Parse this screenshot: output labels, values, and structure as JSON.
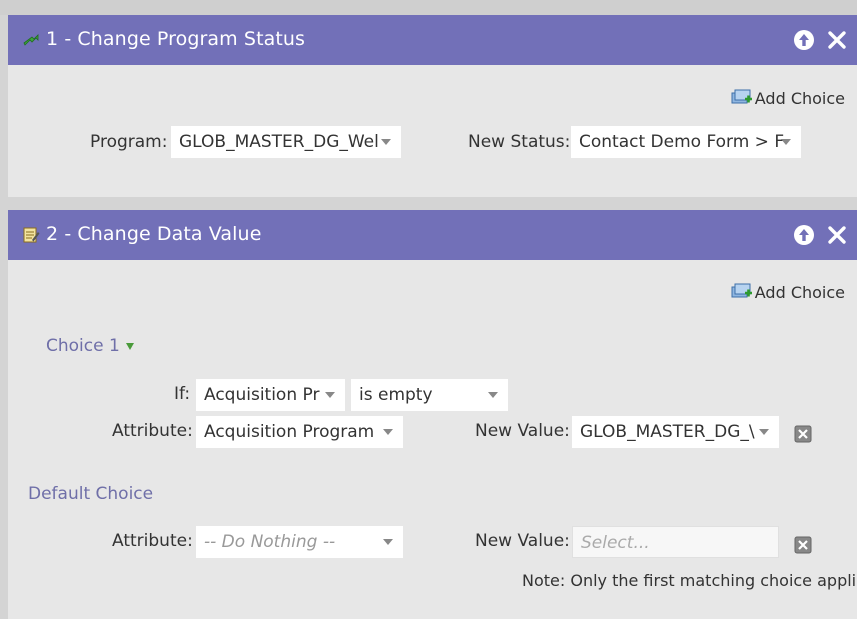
{
  "panels": [
    {
      "title": "1 - Change Program Status",
      "add_choice": "Add Choice",
      "program_label": "Program:",
      "program_value": "GLOB_MASTER_DG_Wel",
      "new_status_label": "New Status:",
      "new_status_value": "Contact Demo Form > F"
    },
    {
      "title": "2 - Change Data Value",
      "add_choice": "Add Choice",
      "choice1_label": "Choice 1",
      "if_label": "If:",
      "if_field": "Acquisition Pr",
      "if_operator": "is empty",
      "attribute_label": "Attribute:",
      "attribute_value": "Acquisition Program",
      "new_value_label": "New Value:",
      "new_value_value": "GLOB_MASTER_DG_\\",
      "default_choice_label": "Default Choice",
      "default_attribute_label": "Attribute:",
      "default_attribute_value": "-- Do Nothing --",
      "default_new_value_label": "New Value:",
      "default_new_value_placeholder": "Select...",
      "note": "Note: Only the first matching choice applies"
    }
  ],
  "colors": {
    "header": "#7270b8",
    "panel_bg": "#e7e7e7",
    "link": "#6f6fa8"
  }
}
